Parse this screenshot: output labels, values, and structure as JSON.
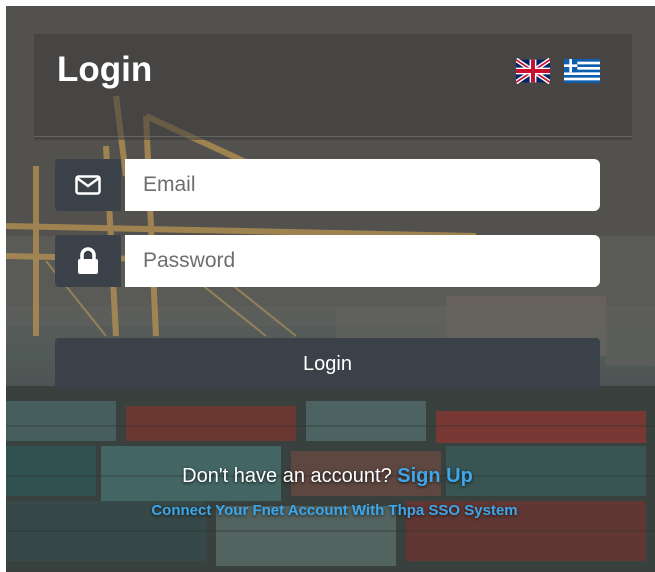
{
  "login_form": {
    "title": "Login",
    "languages": [
      {
        "name": "English",
        "icon": "uk-flag-icon"
      },
      {
        "name": "Greek",
        "icon": "greece-flag-icon"
      }
    ],
    "email": {
      "placeholder": "Email",
      "value": "",
      "icon": "envelope-icon"
    },
    "password": {
      "placeholder": "Password",
      "value": "",
      "icon": "lock-icon"
    },
    "submit_label": "Login"
  },
  "footer": {
    "prompt": "Don't have an account?",
    "signup_label": "Sign Up",
    "sso_link": "Connect Your Fnet Account With Thpa SSO System"
  },
  "colors": {
    "addon_bg": "#3b4148",
    "accent_link": "#3ea7ea",
    "text_light": "#ffffff"
  }
}
